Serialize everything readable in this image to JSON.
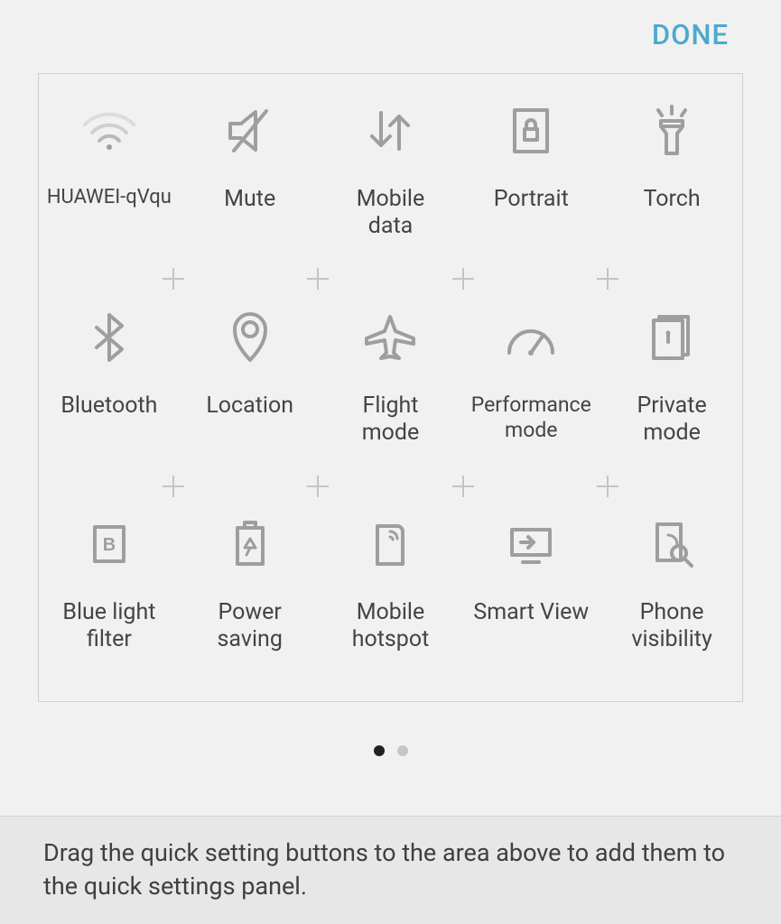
{
  "header": {
    "done_label": "DONE"
  },
  "tiles": [
    {
      "label": "HUAWEI-qVqu"
    },
    {
      "label": "Mute"
    },
    {
      "label": "Mobile\ndata"
    },
    {
      "label": "Portrait"
    },
    {
      "label": "Torch"
    },
    {
      "label": "Bluetooth"
    },
    {
      "label": "Location"
    },
    {
      "label": "Flight\nmode"
    },
    {
      "label": "Performance\nmode"
    },
    {
      "label": "Private\nmode"
    },
    {
      "label": "Blue light\nfilter"
    },
    {
      "label": "Power\nsaving"
    },
    {
      "label": "Mobile\nhotspot"
    },
    {
      "label": "Smart View"
    },
    {
      "label": "Phone\nvisibility"
    }
  ],
  "pager": {
    "pages": 2,
    "active": 0
  },
  "footer": {
    "hint": "Drag the quick setting buttons to the area above to add them to the quick settings panel."
  }
}
